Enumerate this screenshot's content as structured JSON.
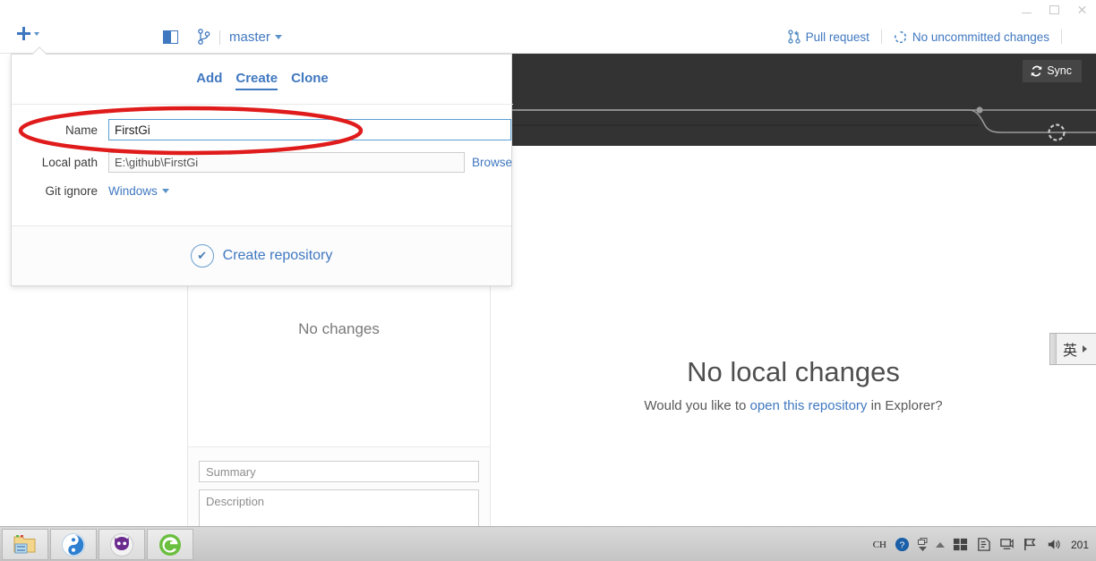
{
  "window": {
    "buttons": {
      "minimize": "minimize",
      "maximize": "maximize",
      "close": "close"
    }
  },
  "toolbar": {
    "add_button_icon": "plus-icon",
    "sidebar_toggle_icon": "sidebar-toggle-icon",
    "branch_icon": "branch-icon",
    "branch_name": "master",
    "pull_request_label": "Pull request",
    "uncommitted_label": "No uncommitted changes",
    "settings_icon": "gear-icon"
  },
  "popup": {
    "tabs": [
      {
        "label": "Add",
        "active": false
      },
      {
        "label": "Create",
        "active": true
      },
      {
        "label": "Clone",
        "active": false
      }
    ],
    "fields": {
      "name_label": "Name",
      "name_value": "FirstGi",
      "path_label": "Local path",
      "path_value": "E:\\github\\FirstGi",
      "browse_label": "Browse",
      "gitignore_label": "Git ignore",
      "gitignore_value": "Windows"
    },
    "create_button_label": "Create repository"
  },
  "changes_panel": {
    "empty_text": "No changes",
    "summary_placeholder": "Summary",
    "description_placeholder": "Description",
    "summary_value": "",
    "description_value": ""
  },
  "history": {
    "sync_label": "Sync",
    "sync_icon": "sync-icon"
  },
  "right_content": {
    "title": "No local changes",
    "subtitle_before": "Would you like to ",
    "subtitle_link": "open this repository",
    "subtitle_after": " in Explorer?"
  },
  "ime": {
    "mode_char": "英"
  },
  "taskbar": {
    "apps": [
      {
        "name": "file-explorer"
      },
      {
        "name": "sogou-browser"
      },
      {
        "name": "github-desktop"
      },
      {
        "name": "360-browser"
      }
    ],
    "tray": {
      "ime_indicator": "CH",
      "help_icon": "help-icon",
      "show_hidden_icon": "show-hidden-icons",
      "windows_icon": "windows-icon",
      "security_icon": "action-center-icon",
      "network_icon": "network-icon",
      "flag_icon": "flag-icon",
      "volume_icon": "volume-icon",
      "clock": "201"
    }
  },
  "colors": {
    "accent_blue": "#4078c0",
    "dark_bar": "#333333",
    "annotation_red": "#e01b1b"
  }
}
